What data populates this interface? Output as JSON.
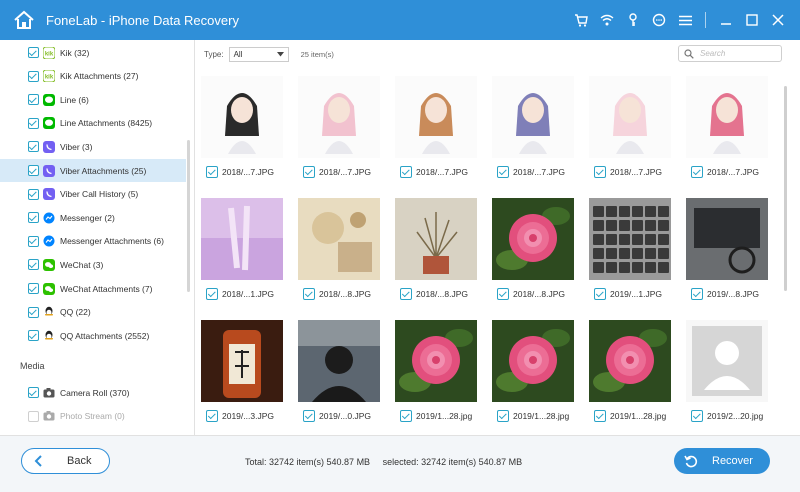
{
  "app": {
    "title": "FoneLab - iPhone Data Recovery"
  },
  "sidebar": {
    "items": [
      {
        "label": "Kik (32)",
        "icon": "kik-icon",
        "color": "#82bc23",
        "checked": true
      },
      {
        "label": "Kik Attachments (27)",
        "icon": "kik-icon",
        "color": "#82bc23",
        "checked": true
      },
      {
        "label": "Line (6)",
        "icon": "line-icon",
        "color": "#00b900",
        "checked": true
      },
      {
        "label": "Line Attachments (8425)",
        "icon": "line-icon",
        "color": "#00b900",
        "checked": true
      },
      {
        "label": "Viber (3)",
        "icon": "viber-icon",
        "color": "#7360f2",
        "checked": true
      },
      {
        "label": "Viber Attachments (25)",
        "icon": "viber-icon",
        "color": "#7360f2",
        "checked": true,
        "selected": true
      },
      {
        "label": "Viber Call History (5)",
        "icon": "viber-icon",
        "color": "#7360f2",
        "checked": true
      },
      {
        "label": "Messenger (2)",
        "icon": "messenger-icon",
        "color": "#0084ff",
        "checked": true
      },
      {
        "label": "Messenger Attachments (6)",
        "icon": "messenger-icon",
        "color": "#0084ff",
        "checked": true
      },
      {
        "label": "WeChat (3)",
        "icon": "wechat-icon",
        "color": "#2dc100",
        "checked": true
      },
      {
        "label": "WeChat Attachments (7)",
        "icon": "wechat-icon",
        "color": "#2dc100",
        "checked": true
      },
      {
        "label": "QQ (22)",
        "icon": "qq-icon",
        "color": "#e3a21a",
        "checked": true
      },
      {
        "label": "QQ Attachments (2552)",
        "icon": "qq-icon",
        "color": "#e3a21a",
        "checked": true
      }
    ],
    "media_heading": "Media",
    "media_items": [
      {
        "label": "Camera Roll (370)",
        "icon": "camera-icon",
        "color": "#555555",
        "checked": true
      },
      {
        "label": "Photo Stream (0)",
        "icon": "camera-icon",
        "color": "#aaaaaa",
        "checked": false
      }
    ]
  },
  "toolbar": {
    "type_label": "Type:",
    "type_value": "All",
    "item_count": "25 item(s)",
    "search_placeholder": "Search"
  },
  "grid": {
    "items": [
      {
        "name": "2018/...7.JPG",
        "thumb": "illustration-1"
      },
      {
        "name": "2018/...7.JPG",
        "thumb": "illustration-2"
      },
      {
        "name": "2018/...7.JPG",
        "thumb": "illustration-3"
      },
      {
        "name": "2018/...7.JPG",
        "thumb": "illustration-4"
      },
      {
        "name": "2018/...7.JPG",
        "thumb": "illustration-5"
      },
      {
        "name": "2018/...7.JPG",
        "thumb": "illustration-6"
      },
      {
        "name": "2018/...1.JPG",
        "thumb": "ballet-photo"
      },
      {
        "name": "2018/...8.JPG",
        "thumb": "vintage-photo"
      },
      {
        "name": "2018/...8.JPG",
        "thumb": "plant-photo"
      },
      {
        "name": "2018/...8.JPG",
        "thumb": "rose-photo"
      },
      {
        "name": "2019/...1.JPG",
        "thumb": "keyboard-photo"
      },
      {
        "name": "2019/...8.JPG",
        "thumb": "desk-photo"
      },
      {
        "name": "2019/...3.JPG",
        "thumb": "bottle-photo"
      },
      {
        "name": "2019/...0.JPG",
        "thumb": "person-photo"
      },
      {
        "name": "2019/1...28.jpg",
        "thumb": "rose-photo"
      },
      {
        "name": "2019/1...28.jpg",
        "thumb": "rose-photo"
      },
      {
        "name": "2019/1...28.jpg",
        "thumb": "rose-photo"
      },
      {
        "name": "2019/2...20.jpg",
        "thumb": "avatar-placeholder"
      }
    ]
  },
  "footer": {
    "back_label": "Back",
    "total_text": "Total: 32742 item(s) 540.87 MB",
    "selected_text": "selected: 32742 item(s) 540.87 MB",
    "recover_label": "Recover"
  },
  "colors": {
    "accent": "#2f8fd8",
    "check": "#2aa3c7",
    "selected_row": "#d7eaf8"
  }
}
